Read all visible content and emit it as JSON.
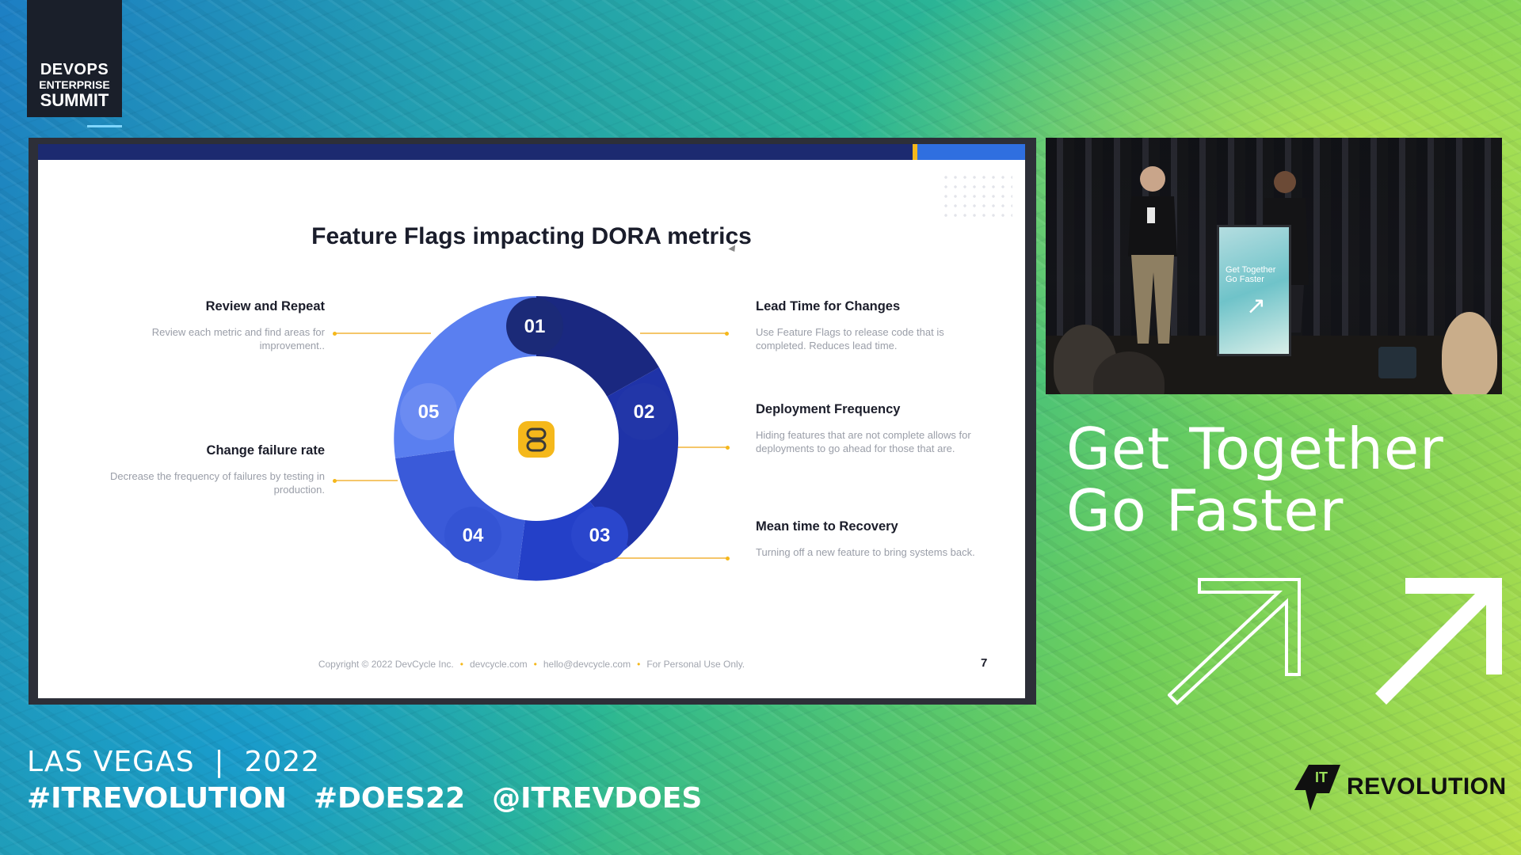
{
  "brand": {
    "logo_lines": [
      "DEVOPS",
      "ENTERPRISE",
      "SUMMIT"
    ]
  },
  "slide": {
    "title": "Feature Flags impacting DORA metrics",
    "segments": [
      "01",
      "02",
      "03",
      "04",
      "05"
    ],
    "metrics": [
      {
        "title": "Review and Repeat",
        "desc": "Review each metric and find areas for improvement..",
        "side": "left"
      },
      {
        "title": "Change failure rate",
        "desc": "Decrease the frequency of failures by testing in production.",
        "side": "left"
      },
      {
        "title": "Lead Time for Changes",
        "desc": "Use Feature Flags to release code that is completed.  Reduces lead time.",
        "side": "right"
      },
      {
        "title": "Deployment Frequency",
        "desc": "Hiding features that are not complete allows for deployments to go ahead for those that are.",
        "side": "right"
      },
      {
        "title": "Mean time to Recovery",
        "desc": "Turning off a new feature to bring systems back.",
        "side": "right"
      }
    ],
    "footer": {
      "copyright": "Copyright © 2022 DevCycle Inc.",
      "site": "devcycle.com",
      "email": "hello@devcycle.com",
      "note": "For Personal Use Only."
    },
    "page_number": "7",
    "colors": {
      "navy": "#1c2a70",
      "accent": "#f5b81b",
      "blue": "#2f6fe0"
    }
  },
  "camera": {
    "podium_text": [
      "Get Together",
      "Go Faster"
    ]
  },
  "tagline": {
    "line1": "Get Together",
    "line2": "Go Faster"
  },
  "event": {
    "city_year": "LAS VEGAS  |  2022",
    "hashtags": [
      "#ITREVOLUTION",
      "#DOES22",
      "@ITREVDOES"
    ]
  },
  "sponsor": {
    "it": "IT",
    "name": "REVOLUTION"
  }
}
